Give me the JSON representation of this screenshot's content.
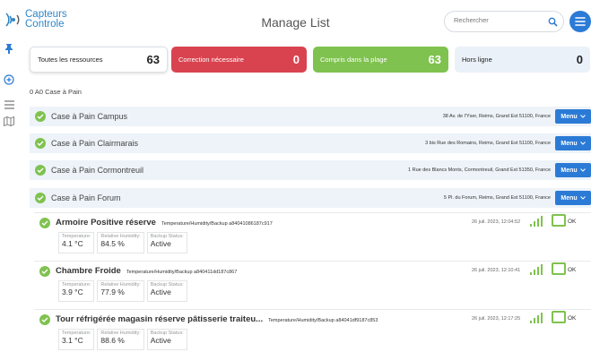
{
  "brand": {
    "line1": "Capteurs",
    "line2": "Controle",
    "color": "#2f86c8"
  },
  "header": {
    "title": "Manage List"
  },
  "search": {
    "placeholder": "Rechercher"
  },
  "accent": "#2b7bd6",
  "summary": [
    {
      "label": "Toutes les ressources",
      "count": "63"
    },
    {
      "label": "Correction nécessaire",
      "count": "0",
      "color": "#d9434f"
    },
    {
      "label": "Compris dans la plage",
      "count": "63",
      "color": "#7fc24f"
    },
    {
      "label": "Hors ligne",
      "count": "0"
    }
  ],
  "breadcrumb": "0 A0 Case à Pain",
  "groups": [
    {
      "name": "Case à Pain Campus",
      "address": "38 Av. de l'Yser, Reims, Grand Est 51100, France",
      "menu": "Menu"
    },
    {
      "name": "Case à Pain Clairmarais",
      "address": "3 bis Rue des Romains, Reims, Grand Est 51100, France",
      "menu": "Menu"
    },
    {
      "name": "Case à Pain Cormontreuil",
      "address": "1 Rue des Blancs Monts, Cormontreuil, Grand Est 51350, France",
      "menu": "Menu"
    },
    {
      "name": "Case à Pain Forum",
      "address": "5 Pl. du Forum, Reims, Grand Est 51100, France",
      "menu": "Menu"
    }
  ],
  "devices": [
    {
      "name": "Armoire Positive réserve",
      "meta": "Temperature/Humidity/Backup a84041086187c917",
      "date": "26 juil. 2023, 12:04:52",
      "status": "OK",
      "temp_label": "Temperature:",
      "temp": "4.1 °C",
      "hum_label": "Relative Humidity:",
      "hum": "84.5 %",
      "backup_label": "Backup Status:",
      "backup": "Active"
    },
    {
      "name": "Chambre Froide",
      "meta": "Temperature/Humidity/Backup a840411dd187c867",
      "date": "26 juil. 2023, 12:10:41",
      "status": "OK",
      "temp_label": "Temperature:",
      "temp": "3.9 °C",
      "hum_label": "Relative Humidity:",
      "hum": "77.9 %",
      "backup_label": "Backup Status:",
      "backup": "Active"
    },
    {
      "name": "Tour réfrigérée magasin réserve pâtisserie traiteu...",
      "meta": "Temperature/Humidity/Backup a84041df9187c853",
      "date": "26 juil. 2023, 12:17:25",
      "status": "OK",
      "temp_label": "Temperature:",
      "temp": "3.1 °C",
      "hum_label": "Relative Humidity:",
      "hum": "88.6 %",
      "backup_label": "Backup Status:",
      "backup": "Active"
    }
  ]
}
